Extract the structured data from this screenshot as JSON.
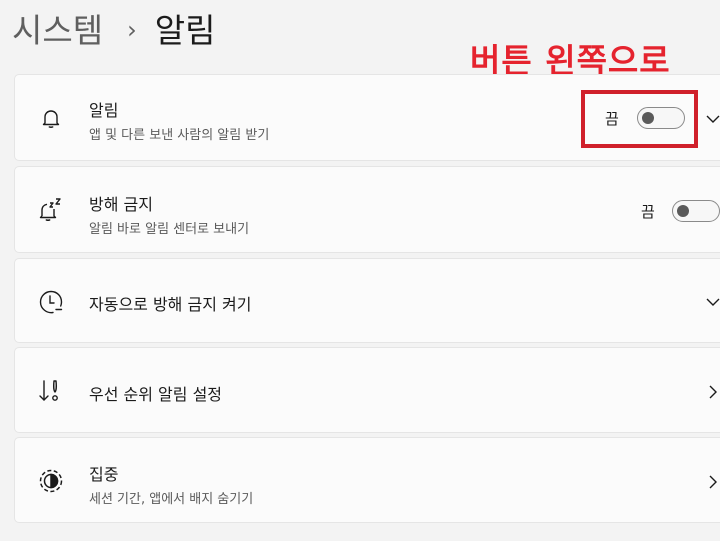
{
  "breadcrumb": {
    "parent": "시스템",
    "separator": "›",
    "current": "알림"
  },
  "annotation": {
    "text": "버튼 왼쪽으로",
    "color": "#e5232e",
    "box_color": "#d0202b"
  },
  "rows": [
    {
      "title": "알림",
      "subtitle": "앱 및 다른 보낸 사람의 알림 받기",
      "icon": "bell-icon",
      "toggle_state": "끔",
      "toggle_on": false,
      "action": "chevron-down-icon"
    },
    {
      "title": "방해 금지",
      "subtitle": "알림 바로 알림 센터로 보내기",
      "icon": "bell-snooze-icon",
      "toggle_state": "끔",
      "toggle_on": false
    },
    {
      "title": "자동으로 방해 금지 켜기",
      "icon": "clock-icon",
      "action": "chevron-down-icon"
    },
    {
      "title": "우선 순위 알림 설정",
      "icon": "priority-icon",
      "action": "chevron-right-icon"
    },
    {
      "title": "집중",
      "subtitle": "세션 기간, 앱에서 배지 숨기기",
      "icon": "focus-icon",
      "action": "chevron-right-icon"
    }
  ]
}
